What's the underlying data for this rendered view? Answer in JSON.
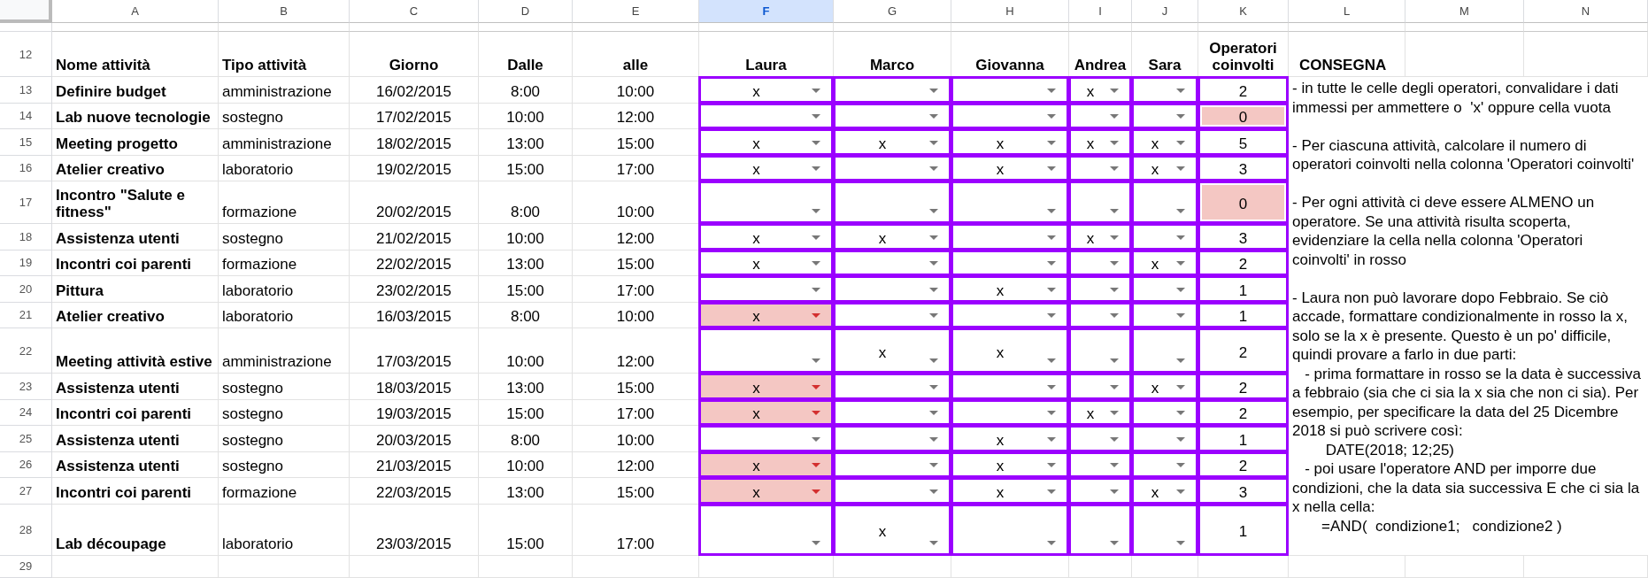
{
  "column_headers": [
    {
      "label": "A",
      "selected": false
    },
    {
      "label": "B",
      "selected": false
    },
    {
      "label": "C",
      "selected": false
    },
    {
      "label": "D",
      "selected": false
    },
    {
      "label": "E",
      "selected": false
    },
    {
      "label": "F",
      "selected": true
    },
    {
      "label": "G",
      "selected": false
    },
    {
      "label": "H",
      "selected": false
    },
    {
      "label": "I",
      "selected": false
    },
    {
      "label": "J",
      "selected": false
    },
    {
      "label": "K",
      "selected": false
    },
    {
      "label": "L",
      "selected": false
    },
    {
      "label": "M",
      "selected": false
    },
    {
      "label": "N",
      "selected": false
    }
  ],
  "header_row": {
    "number": "12",
    "labels": [
      "Nome attività",
      "Tipo attività",
      "Giorno",
      "Dalle",
      "alle",
      "Laura",
      "Marco",
      "Giovanna",
      "Andrea",
      "Sara",
      "Operatori coinvolti"
    ],
    "instructions_title": "CONSEGNA"
  },
  "rows": [
    {
      "number": "13",
      "name": "Definire budget",
      "type": "amministrazione",
      "day": "16/02/2015",
      "from": "8:00",
      "to": "10:00",
      "operators": [
        {
          "value": "x",
          "flagged": false
        },
        {
          "flagged": false
        },
        {
          "flagged": false
        },
        {
          "value": "x",
          "flagged": false
        },
        {
          "flagged": false
        }
      ],
      "count": "2",
      "uncovered": false
    },
    {
      "number": "14",
      "name": "Lab nuove tecnologie",
      "type": "sostegno",
      "day": "17/02/2015",
      "from": "10:00",
      "to": "12:00",
      "operators": [
        {
          "flagged": false
        },
        {
          "flagged": false
        },
        {
          "flagged": false
        },
        {
          "flagged": false
        },
        {
          "flagged": false
        }
      ],
      "count": "0",
      "uncovered": true
    },
    {
      "number": "15",
      "name": "Meeting progetto",
      "type": "amministrazione",
      "day": "18/02/2015",
      "from": "13:00",
      "to": "15:00",
      "operators": [
        {
          "value": "x",
          "flagged": false
        },
        {
          "value": "x",
          "flagged": false
        },
        {
          "value": "x",
          "flagged": false
        },
        {
          "value": "x",
          "flagged": false
        },
        {
          "value": "x",
          "flagged": false
        }
      ],
      "count": "5",
      "uncovered": false
    },
    {
      "number": "16",
      "name": "Atelier creativo",
      "type": "laboratorio",
      "day": "19/02/2015",
      "from": "15:00",
      "to": "17:00",
      "operators": [
        {
          "value": "x",
          "flagged": false
        },
        {
          "flagged": false
        },
        {
          "value": "x",
          "flagged": false
        },
        {
          "flagged": false
        },
        {
          "value": "x",
          "flagged": false
        }
      ],
      "count": "3",
      "uncovered": false
    },
    {
      "number": "17",
      "name": "Incontro \"Salute e fitness\"",
      "type": "formazione",
      "day": "20/02/2015",
      "from": "8:00",
      "to": "10:00",
      "operators": [
        {
          "flagged": false
        },
        {
          "flagged": false
        },
        {
          "flagged": false
        },
        {
          "flagged": false
        },
        {
          "flagged": false
        }
      ],
      "count": "0",
      "uncovered": true
    },
    {
      "number": "18",
      "name": "Assistenza utenti",
      "type": "sostegno",
      "day": "21/02/2015",
      "from": "10:00",
      "to": "12:00",
      "operators": [
        {
          "value": "x",
          "flagged": false
        },
        {
          "value": "x",
          "flagged": false
        },
        {
          "flagged": false
        },
        {
          "value": "x",
          "flagged": false
        },
        {
          "flagged": false
        }
      ],
      "count": "3",
      "uncovered": false
    },
    {
      "number": "19",
      "name": "Incontri coi parenti",
      "type": "formazione",
      "day": "22/02/2015",
      "from": "13:00",
      "to": "15:00",
      "operators": [
        {
          "value": "x",
          "flagged": false
        },
        {
          "flagged": false
        },
        {
          "flagged": false
        },
        {
          "flagged": false
        },
        {
          "value": "x",
          "flagged": false
        }
      ],
      "count": "2",
      "uncovered": false
    },
    {
      "number": "20",
      "name": "Pittura",
      "type": "laboratorio",
      "day": "23/02/2015",
      "from": "15:00",
      "to": "17:00",
      "operators": [
        {
          "flagged": false
        },
        {
          "flagged": false
        },
        {
          "value": "x",
          "flagged": false
        },
        {
          "flagged": false
        },
        {
          "flagged": false
        }
      ],
      "count": "1",
      "uncovered": false
    },
    {
      "number": "21",
      "name": "Atelier creativo",
      "type": "laboratorio",
      "day": "16/03/2015",
      "from": "8:00",
      "to": "10:00",
      "operators": [
        {
          "value": "x",
          "flagged": true
        },
        {
          "flagged": false
        },
        {
          "flagged": false
        },
        {
          "flagged": false
        },
        {
          "flagged": false
        }
      ],
      "count": "1",
      "uncovered": false
    },
    {
      "number": "22",
      "name": "Meeting attività estive",
      "type": "amministrazione",
      "day": "17/03/2015",
      "from": "10:00",
      "to": "12:00",
      "operators": [
        {
          "flagged": false
        },
        {
          "value": "x",
          "flagged": false
        },
        {
          "value": "x",
          "flagged": false
        },
        {
          "flagged": false
        },
        {
          "flagged": false
        }
      ],
      "count": "2",
      "uncovered": false
    },
    {
      "number": "23",
      "name": "Assistenza utenti",
      "type": "sostegno",
      "day": "18/03/2015",
      "from": "13:00",
      "to": "15:00",
      "operators": [
        {
          "value": "x",
          "flagged": true
        },
        {
          "flagged": false
        },
        {
          "flagged": false
        },
        {
          "flagged": false
        },
        {
          "value": "x",
          "flagged": false
        }
      ],
      "count": "2",
      "uncovered": false
    },
    {
      "number": "24",
      "name": "Incontri coi parenti",
      "type": "sostegno",
      "day": "19/03/2015",
      "from": "15:00",
      "to": "17:00",
      "operators": [
        {
          "value": "x",
          "flagged": true
        },
        {
          "flagged": false
        },
        {
          "flagged": false
        },
        {
          "value": "x",
          "flagged": false
        },
        {
          "flagged": false
        }
      ],
      "count": "2",
      "uncovered": false
    },
    {
      "number": "25",
      "name": "Assistenza utenti",
      "type": "sostegno",
      "day": "20/03/2015",
      "from": "8:00",
      "to": "10:00",
      "operators": [
        {
          "flagged": false
        },
        {
          "flagged": false
        },
        {
          "value": "x",
          "flagged": false
        },
        {
          "flagged": false
        },
        {
          "flagged": false
        }
      ],
      "count": "1",
      "uncovered": false
    },
    {
      "number": "26",
      "name": "Assistenza utenti",
      "type": "sostegno",
      "day": "21/03/2015",
      "from": "10:00",
      "to": "12:00",
      "operators": [
        {
          "value": "x",
          "flagged": true
        },
        {
          "flagged": false
        },
        {
          "value": "x",
          "flagged": false
        },
        {
          "flagged": false
        },
        {
          "flagged": false
        }
      ],
      "count": "2",
      "uncovered": false
    },
    {
      "number": "27",
      "name": "Incontri coi parenti",
      "type": "formazione",
      "day": "22/03/2015",
      "from": "13:00",
      "to": "15:00",
      "operators": [
        {
          "value": "x",
          "flagged": true
        },
        {
          "flagged": false
        },
        {
          "value": "x",
          "flagged": false
        },
        {
          "flagged": false
        },
        {
          "value": "x",
          "flagged": false
        }
      ],
      "count": "3",
      "uncovered": false
    },
    {
      "number": "28",
      "name": "Lab découpage",
      "type": "laboratorio",
      "day": "23/03/2015",
      "from": "15:00",
      "to": "17:00",
      "operators": [
        {
          "flagged": false
        },
        {
          "value": "x",
          "flagged": false
        },
        {
          "flagged": false
        },
        {
          "flagged": false
        },
        {
          "flagged": false
        }
      ],
      "count": "1",
      "uncovered": false
    }
  ],
  "instructions": [
    "- in tutte le celle degli operatori, convalidare i dati immessi per ammettere o  'x' oppure cella vuota",
    "- Per ciascuna attività, calcolare il numero di operatori coinvolti nella colonna 'Operatori coinvolti'",
    "- Per ogni attività ci deve essere ALMENO un operatore. Se una attività risulta scoperta, evidenziare la cella nella colonna 'Operatori coinvolti' in rosso",
    "- Laura non può lavorare dopo Febbraio. Se ciò accade, formattare condizionalmente in rosso la x, solo se la x è presente. Questo è un po' difficile, quindi provare a farlo in due parti:\n   - prima formattare in rosso se la data è successiva a febbraio (sia che ci sia la x sia che non ci sia). Per esempio, per specificare la data del 25 Dicembre 2018 si può scrivere così:\n        DATE(2018; 12;25)\n   - poi usare l'operatore AND per imporre due condizioni, che la data sia successiva E che ci sia la x nella cella:\n       =AND(  condizione1;   condizione2 )"
  ],
  "last_row": {
    "number": "29"
  }
}
